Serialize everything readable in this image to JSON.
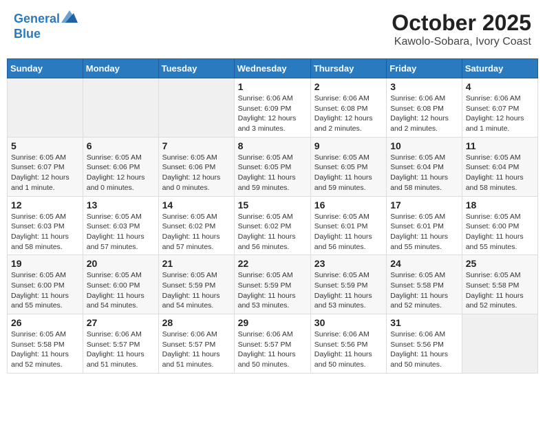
{
  "header": {
    "logo_line1": "General",
    "logo_line2": "Blue",
    "month": "October 2025",
    "location": "Kawolo-Sobara, Ivory Coast"
  },
  "weekdays": [
    "Sunday",
    "Monday",
    "Tuesday",
    "Wednesday",
    "Thursday",
    "Friday",
    "Saturday"
  ],
  "weeks": [
    [
      {
        "day": "",
        "info": ""
      },
      {
        "day": "",
        "info": ""
      },
      {
        "day": "",
        "info": ""
      },
      {
        "day": "1",
        "info": "Sunrise: 6:06 AM\nSunset: 6:09 PM\nDaylight: 12 hours\nand 3 minutes."
      },
      {
        "day": "2",
        "info": "Sunrise: 6:06 AM\nSunset: 6:08 PM\nDaylight: 12 hours\nand 2 minutes."
      },
      {
        "day": "3",
        "info": "Sunrise: 6:06 AM\nSunset: 6:08 PM\nDaylight: 12 hours\nand 2 minutes."
      },
      {
        "day": "4",
        "info": "Sunrise: 6:06 AM\nSunset: 6:07 PM\nDaylight: 12 hours\nand 1 minute."
      }
    ],
    [
      {
        "day": "5",
        "info": "Sunrise: 6:05 AM\nSunset: 6:07 PM\nDaylight: 12 hours\nand 1 minute."
      },
      {
        "day": "6",
        "info": "Sunrise: 6:05 AM\nSunset: 6:06 PM\nDaylight: 12 hours\nand 0 minutes."
      },
      {
        "day": "7",
        "info": "Sunrise: 6:05 AM\nSunset: 6:06 PM\nDaylight: 12 hours\nand 0 minutes."
      },
      {
        "day": "8",
        "info": "Sunrise: 6:05 AM\nSunset: 6:05 PM\nDaylight: 11 hours\nand 59 minutes."
      },
      {
        "day": "9",
        "info": "Sunrise: 6:05 AM\nSunset: 6:05 PM\nDaylight: 11 hours\nand 59 minutes."
      },
      {
        "day": "10",
        "info": "Sunrise: 6:05 AM\nSunset: 6:04 PM\nDaylight: 11 hours\nand 58 minutes."
      },
      {
        "day": "11",
        "info": "Sunrise: 6:05 AM\nSunset: 6:04 PM\nDaylight: 11 hours\nand 58 minutes."
      }
    ],
    [
      {
        "day": "12",
        "info": "Sunrise: 6:05 AM\nSunset: 6:03 PM\nDaylight: 11 hours\nand 58 minutes."
      },
      {
        "day": "13",
        "info": "Sunrise: 6:05 AM\nSunset: 6:03 PM\nDaylight: 11 hours\nand 57 minutes."
      },
      {
        "day": "14",
        "info": "Sunrise: 6:05 AM\nSunset: 6:02 PM\nDaylight: 11 hours\nand 57 minutes."
      },
      {
        "day": "15",
        "info": "Sunrise: 6:05 AM\nSunset: 6:02 PM\nDaylight: 11 hours\nand 56 minutes."
      },
      {
        "day": "16",
        "info": "Sunrise: 6:05 AM\nSunset: 6:01 PM\nDaylight: 11 hours\nand 56 minutes."
      },
      {
        "day": "17",
        "info": "Sunrise: 6:05 AM\nSunset: 6:01 PM\nDaylight: 11 hours\nand 55 minutes."
      },
      {
        "day": "18",
        "info": "Sunrise: 6:05 AM\nSunset: 6:00 PM\nDaylight: 11 hours\nand 55 minutes."
      }
    ],
    [
      {
        "day": "19",
        "info": "Sunrise: 6:05 AM\nSunset: 6:00 PM\nDaylight: 11 hours\nand 55 minutes."
      },
      {
        "day": "20",
        "info": "Sunrise: 6:05 AM\nSunset: 6:00 PM\nDaylight: 11 hours\nand 54 minutes."
      },
      {
        "day": "21",
        "info": "Sunrise: 6:05 AM\nSunset: 5:59 PM\nDaylight: 11 hours\nand 54 minutes."
      },
      {
        "day": "22",
        "info": "Sunrise: 6:05 AM\nSunset: 5:59 PM\nDaylight: 11 hours\nand 53 minutes."
      },
      {
        "day": "23",
        "info": "Sunrise: 6:05 AM\nSunset: 5:59 PM\nDaylight: 11 hours\nand 53 minutes."
      },
      {
        "day": "24",
        "info": "Sunrise: 6:05 AM\nSunset: 5:58 PM\nDaylight: 11 hours\nand 52 minutes."
      },
      {
        "day": "25",
        "info": "Sunrise: 6:05 AM\nSunset: 5:58 PM\nDaylight: 11 hours\nand 52 minutes."
      }
    ],
    [
      {
        "day": "26",
        "info": "Sunrise: 6:05 AM\nSunset: 5:58 PM\nDaylight: 11 hours\nand 52 minutes."
      },
      {
        "day": "27",
        "info": "Sunrise: 6:06 AM\nSunset: 5:57 PM\nDaylight: 11 hours\nand 51 minutes."
      },
      {
        "day": "28",
        "info": "Sunrise: 6:06 AM\nSunset: 5:57 PM\nDaylight: 11 hours\nand 51 minutes."
      },
      {
        "day": "29",
        "info": "Sunrise: 6:06 AM\nSunset: 5:57 PM\nDaylight: 11 hours\nand 50 minutes."
      },
      {
        "day": "30",
        "info": "Sunrise: 6:06 AM\nSunset: 5:56 PM\nDaylight: 11 hours\nand 50 minutes."
      },
      {
        "day": "31",
        "info": "Sunrise: 6:06 AM\nSunset: 5:56 PM\nDaylight: 11 hours\nand 50 minutes."
      },
      {
        "day": "",
        "info": ""
      }
    ]
  ]
}
